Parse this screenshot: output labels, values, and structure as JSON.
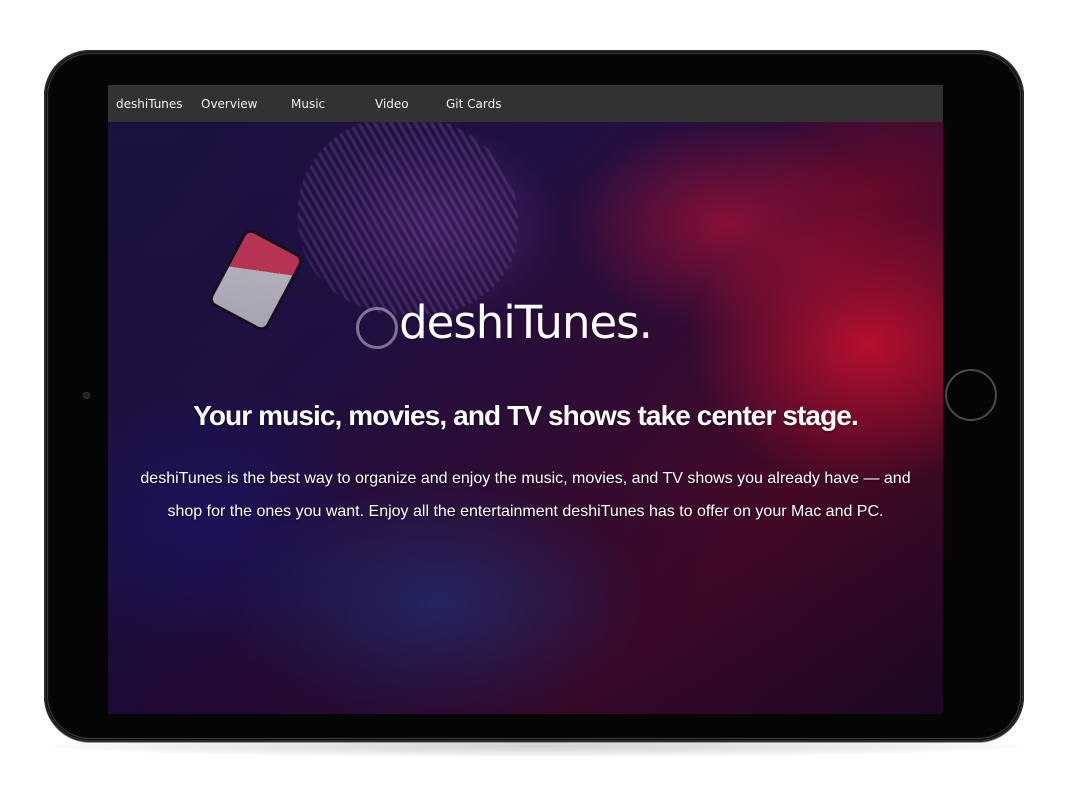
{
  "nav": {
    "items": [
      {
        "label": "deshiTunes"
      },
      {
        "label": "Overview"
      },
      {
        "label": "Music"
      },
      {
        "label": "Video"
      },
      {
        "label": "Git Cards"
      }
    ]
  },
  "hero": {
    "title": "deshiTunes.",
    "tagline": "Your music, movies, and TV shows take center stage.",
    "description": "deshiTunes is the best way to organize and enjoy the music, movies, and TV shows you already have — and shop for the ones you want. Enjoy all the entertainment deshiTunes has to offer on your Mac and PC."
  },
  "colors": {
    "navbar": "#323232",
    "nav_text": "#f2f2f2",
    "hero_text": "#ffffff",
    "device_frame": "#050505"
  }
}
